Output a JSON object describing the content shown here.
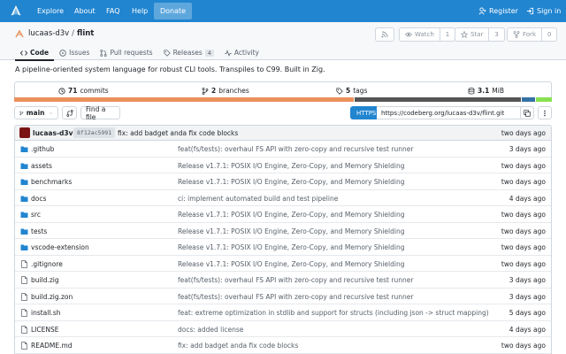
{
  "nav": {
    "items": [
      "Explore",
      "About",
      "FAQ",
      "Help"
    ],
    "donate": "Donate",
    "register": "Register",
    "signin": "Sign in",
    "brand_color": "#2185d0"
  },
  "repo": {
    "owner": "lucaas-d3v",
    "separator": "/",
    "name": "flint",
    "watch_label": "Watch",
    "watch_count": "1",
    "star_label": "Star",
    "star_count": "3",
    "fork_label": "Fork",
    "fork_count": "0"
  },
  "tabs": [
    {
      "label": "Code",
      "icon": "code-icon"
    },
    {
      "label": "Issues",
      "icon": "issues-icon"
    },
    {
      "label": "Pull requests",
      "icon": "pull-request-icon"
    },
    {
      "label": "Releases",
      "icon": "tag-icon",
      "badge": "4"
    },
    {
      "label": "Activity",
      "icon": "pulse-icon"
    }
  ],
  "description": "A pipeline-oriented system language for robust CLI tools. Transpiles to C99. Built in Zig.",
  "stats": {
    "commits_count": "71",
    "commits_label": "commits",
    "branches_count": "2",
    "branches_label": "branches",
    "tags_count": "5",
    "tags_label": "tags",
    "size_value": "3.1",
    "size_unit": "MiB"
  },
  "languages": [
    {
      "color": "#ec915c",
      "fraction": 0.635
    },
    {
      "color": "#555555",
      "fraction": 0.31
    },
    {
      "color": "#3572a5",
      "fraction": 0.025
    },
    {
      "color": "#89e051",
      "fraction": 0.03
    }
  ],
  "controls": {
    "branch": "main",
    "find_file": "Find a file",
    "protocol": "HTTPS",
    "clone_url": "https://codeberg.org/lucaas-d3v/flint.git"
  },
  "latest_commit": {
    "author": "lucaas-d3v",
    "sha": "8f12ac5991",
    "message": "fix: add badget anda fix code blocks",
    "time": "two days ago"
  },
  "files": [
    {
      "type": "dir",
      "name": ".github",
      "message": "feat(fs/tests): overhaul FS API with zero-copy and recursive test runner",
      "time": "3 days ago"
    },
    {
      "type": "dir",
      "name": "assets",
      "message": "Release v1.7.1: POSIX I/O Engine, Zero-Copy, and Memory Shielding",
      "time": "two days ago"
    },
    {
      "type": "dir",
      "name": "benchmarks",
      "message": "Release v1.7.1: POSIX I/O Engine, Zero-Copy, and Memory Shielding",
      "time": "two days ago"
    },
    {
      "type": "dir",
      "name": "docs",
      "message": "ci: implement automated build and test pipeline",
      "time": "4 days ago"
    },
    {
      "type": "dir",
      "name": "src",
      "message": "Release v1.7.1: POSIX I/O Engine, Zero-Copy, and Memory Shielding",
      "time": "two days ago"
    },
    {
      "type": "dir",
      "name": "tests",
      "message": "Release v1.7.1: POSIX I/O Engine, Zero-Copy, and Memory Shielding",
      "time": "two days ago"
    },
    {
      "type": "dir",
      "name": "vscode-extension",
      "message": "Release v1.7.1: POSIX I/O Engine, Zero-Copy, and Memory Shielding",
      "time": "two days ago"
    },
    {
      "type": "file",
      "name": ".gitignore",
      "message": "Release v1.7.1: POSIX I/O Engine, Zero-Copy, and Memory Shielding",
      "time": "two days ago"
    },
    {
      "type": "file",
      "name": "build.zig",
      "message": "feat(fs/tests): overhaul FS API with zero-copy and recursive test runner",
      "time": "3 days ago"
    },
    {
      "type": "file",
      "name": "build.zig.zon",
      "message": "feat(fs/tests): overhaul FS API with zero-copy and recursive test runner",
      "time": "3 days ago"
    },
    {
      "type": "file",
      "name": "install.sh",
      "message": "feat: extreme optimization in stdlib and support for structs (including json -> struct mapping)",
      "time": "5 days ago"
    },
    {
      "type": "file",
      "name": "LICENSE",
      "message": "docs: added license",
      "time": "4 days ago"
    },
    {
      "type": "file",
      "name": "README.md",
      "message": "fix: add badget anda fix code blocks",
      "time": "two days ago"
    }
  ]
}
